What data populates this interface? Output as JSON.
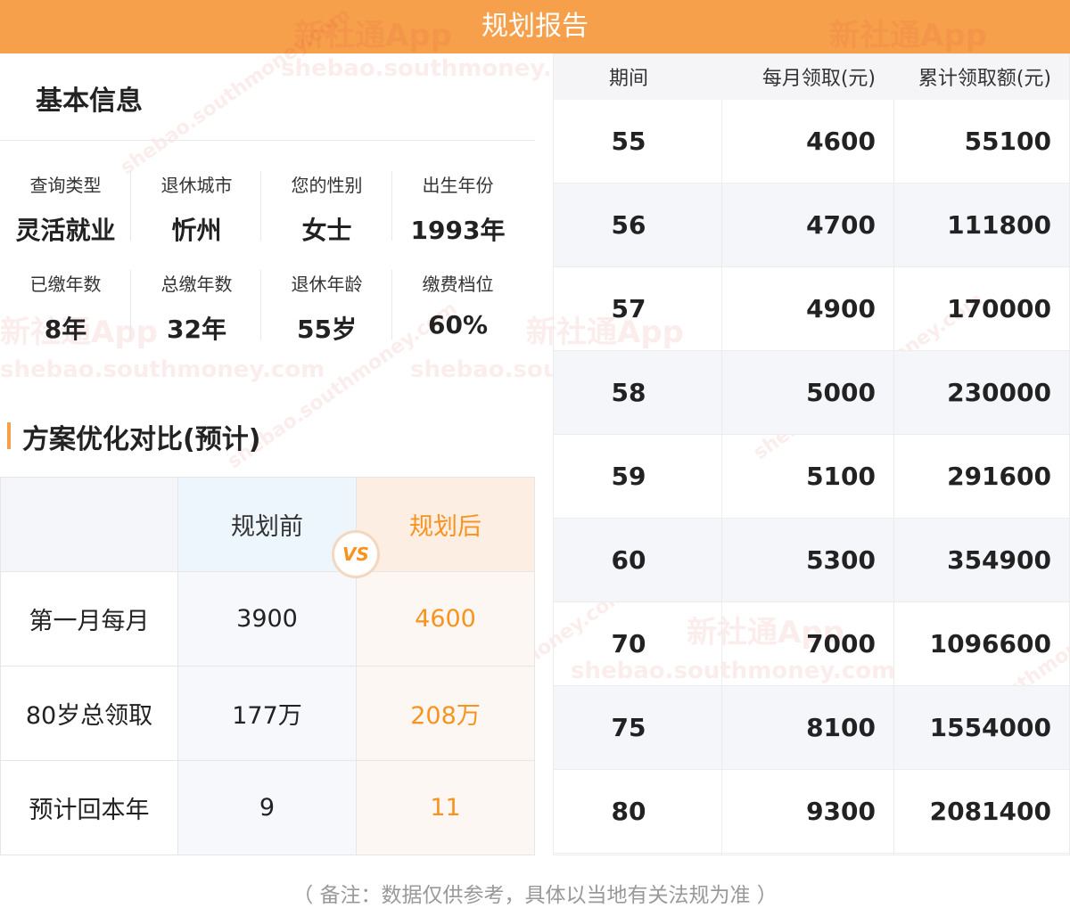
{
  "header": {
    "title": "规划报告"
  },
  "basic": {
    "title": "基本信息",
    "items": [
      {
        "label": "查询类型",
        "value": "灵活就业"
      },
      {
        "label": "退休城市",
        "value": "忻州"
      },
      {
        "label": "您的性别",
        "value": "女士"
      },
      {
        "label": "出生年份",
        "value": "1993年"
      },
      {
        "label": "已缴年数",
        "value": "8年"
      },
      {
        "label": "总缴年数",
        "value": "32年"
      },
      {
        "label": "退休年龄",
        "value": "55岁"
      },
      {
        "label": "缴费档位",
        "value": "60%"
      }
    ]
  },
  "optimization": {
    "title": "方案优化对比(预计)",
    "before_label": "规划前",
    "after_label": "规划后",
    "vs_label": "VS",
    "rows": [
      {
        "label": "第一月每月",
        "before": "3900",
        "after": "4600"
      },
      {
        "label": "80岁总领取",
        "before": "177万",
        "after": "208万"
      },
      {
        "label": "预计回本年",
        "before": "9",
        "after": "11"
      }
    ]
  },
  "schedule": {
    "headers": [
      "期间",
      "每月领取(元)",
      "累计领取额(元)"
    ],
    "rows": [
      {
        "period": "55",
        "monthly": "4600",
        "total": "55100"
      },
      {
        "period": "56",
        "monthly": "4700",
        "total": "111800"
      },
      {
        "period": "57",
        "monthly": "4900",
        "total": "170000"
      },
      {
        "period": "58",
        "monthly": "5000",
        "total": "230000"
      },
      {
        "period": "59",
        "monthly": "5100",
        "total": "291600"
      },
      {
        "period": "60",
        "monthly": "5300",
        "total": "354900"
      },
      {
        "period": "70",
        "monthly": "7000",
        "total": "1096600"
      },
      {
        "period": "75",
        "monthly": "8100",
        "total": "1554000"
      },
      {
        "period": "80",
        "monthly": "9300",
        "total": "2081400"
      }
    ]
  },
  "footer": {
    "note": "（ 备注：数据仅供参考，具体以当地有关法规为准 ）"
  },
  "watermark": {
    "text": "新社通App",
    "url": "shebao.southmoney.com"
  },
  "colors": {
    "accent": "#f7a04b",
    "after_text": "#f7931e",
    "before_bg": "#eef6fd",
    "after_bg": "#fdeee4"
  }
}
